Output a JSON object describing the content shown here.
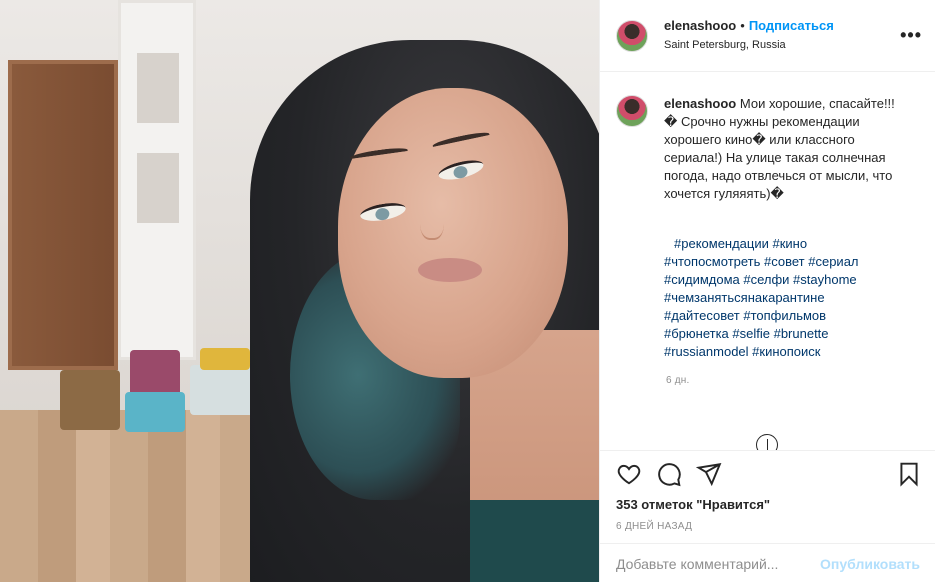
{
  "header": {
    "username": "elenashooo",
    "separator": "•",
    "follow_label": "Подписаться",
    "location": "Saint Petersburg, Russia",
    "more_label": "•••"
  },
  "caption": {
    "username": "elenashooo",
    "text": "Мои хорошие, спасайте!!!� Срочно нужны рекомендации хорошего кино� или классного сериала!) На улице такая солнечная погода, надо отвлечься от мысли, что хочется гуляяять)�",
    "hashtags": [
      "#рекомендации #кино",
      "#чтопосмотреть #совет #сериал",
      "#сидимдома #селфи #stayhome",
      "#чемзанятьсянакарантине",
      "#дайтесовет #топфильмов",
      "#брюнетка #selfie #brunette",
      "#russianmodel #кинопоиск"
    ],
    "time": "6 дн."
  },
  "actions": {
    "like_icon": "heart-icon",
    "comment_icon": "comment-icon",
    "share_icon": "paper-plane-icon",
    "save_icon": "bookmark-icon",
    "likes_text": "353 отметок \"Нравится\"",
    "date": "6 ДНЕЙ НАЗАД"
  },
  "comment_box": {
    "placeholder": "Добавьте комментарий...",
    "publish_label": "Опубликовать"
  },
  "colors": {
    "accent": "#0095f6",
    "link": "#00376b",
    "muted": "#8e8e8e",
    "publish_disabled": "#b2dffc"
  }
}
